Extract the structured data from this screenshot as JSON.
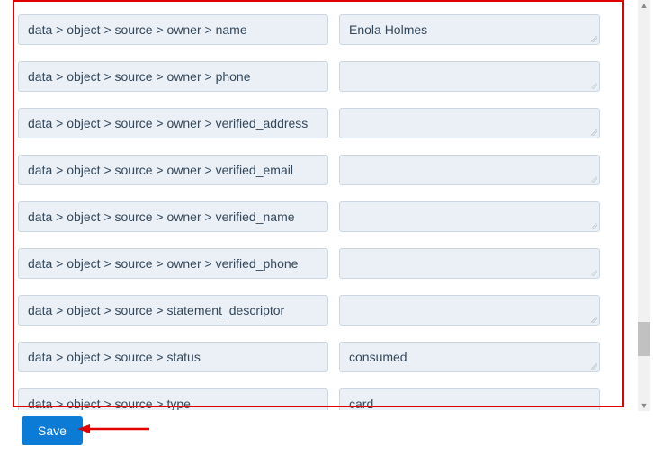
{
  "rows": [
    {
      "label": "data > object > source > owner > name",
      "value": "Enola Holmes"
    },
    {
      "label": "data > object > source > owner > phone",
      "value": ""
    },
    {
      "label": "data > object > source > owner > verified_address",
      "value": ""
    },
    {
      "label": "data > object > source > owner > verified_email",
      "value": ""
    },
    {
      "label": "data > object > source > owner > verified_name",
      "value": ""
    },
    {
      "label": "data > object > source > owner > verified_phone",
      "value": ""
    },
    {
      "label": "data > object > source > statement_descriptor",
      "value": ""
    },
    {
      "label": "data > object > source > status",
      "value": "consumed"
    },
    {
      "label": "data > object > source > type",
      "value": "card"
    }
  ],
  "buttons": {
    "save": "Save"
  }
}
